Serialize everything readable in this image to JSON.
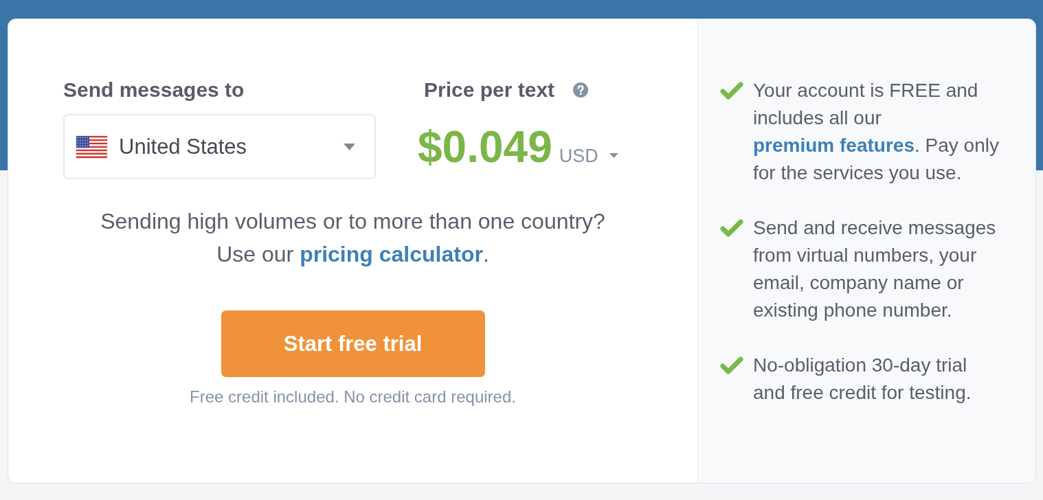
{
  "destination": {
    "label": "Send messages to",
    "country": {
      "value": "United States"
    }
  },
  "price": {
    "label": "Price per text",
    "amount": "$0.049",
    "currency": "USD"
  },
  "volume_note": {
    "question": "Sending high volumes or to more than one country?",
    "text": "Use our ",
    "link": "pricing calculator",
    "after": "."
  },
  "cta": {
    "button": "Start free trial",
    "note": "Free credit included. No credit card required."
  },
  "features": [
    {
      "text": "Your account is FREE and includes all our ",
      "link": "premium features",
      "after": ". Pay only for the services you use."
    },
    {
      "text": "Send and receive messages from virtual numbers, your email, company name or existing phone number."
    },
    {
      "text": "No-obligation 30-day trial and free credit for testing."
    }
  ]
}
